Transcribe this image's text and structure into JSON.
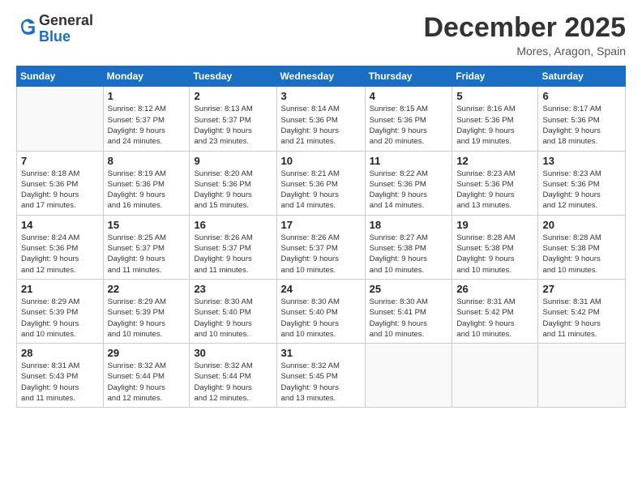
{
  "header": {
    "logo": {
      "line1": "General",
      "line2": "Blue"
    },
    "title": "December 2025",
    "location": "Mores, Aragon, Spain"
  },
  "days_of_week": [
    "Sunday",
    "Monday",
    "Tuesday",
    "Wednesday",
    "Thursday",
    "Friday",
    "Saturday"
  ],
  "weeks": [
    [
      {
        "day": "",
        "info": ""
      },
      {
        "day": "1",
        "info": "Sunrise: 8:12 AM\nSunset: 5:37 PM\nDaylight: 9 hours\nand 24 minutes."
      },
      {
        "day": "2",
        "info": "Sunrise: 8:13 AM\nSunset: 5:37 PM\nDaylight: 9 hours\nand 23 minutes."
      },
      {
        "day": "3",
        "info": "Sunrise: 8:14 AM\nSunset: 5:36 PM\nDaylight: 9 hours\nand 21 minutes."
      },
      {
        "day": "4",
        "info": "Sunrise: 8:15 AM\nSunset: 5:36 PM\nDaylight: 9 hours\nand 20 minutes."
      },
      {
        "day": "5",
        "info": "Sunrise: 8:16 AM\nSunset: 5:36 PM\nDaylight: 9 hours\nand 19 minutes."
      },
      {
        "day": "6",
        "info": "Sunrise: 8:17 AM\nSunset: 5:36 PM\nDaylight: 9 hours\nand 18 minutes."
      }
    ],
    [
      {
        "day": "7",
        "info": "Sunrise: 8:18 AM\nSunset: 5:36 PM\nDaylight: 9 hours\nand 17 minutes."
      },
      {
        "day": "8",
        "info": "Sunrise: 8:19 AM\nSunset: 5:36 PM\nDaylight: 9 hours\nand 16 minutes."
      },
      {
        "day": "9",
        "info": "Sunrise: 8:20 AM\nSunset: 5:36 PM\nDaylight: 9 hours\nand 15 minutes."
      },
      {
        "day": "10",
        "info": "Sunrise: 8:21 AM\nSunset: 5:36 PM\nDaylight: 9 hours\nand 14 minutes."
      },
      {
        "day": "11",
        "info": "Sunrise: 8:22 AM\nSunset: 5:36 PM\nDaylight: 9 hours\nand 14 minutes."
      },
      {
        "day": "12",
        "info": "Sunrise: 8:23 AM\nSunset: 5:36 PM\nDaylight: 9 hours\nand 13 minutes."
      },
      {
        "day": "13",
        "info": "Sunrise: 8:23 AM\nSunset: 5:36 PM\nDaylight: 9 hours\nand 12 minutes."
      }
    ],
    [
      {
        "day": "14",
        "info": "Sunrise: 8:24 AM\nSunset: 5:36 PM\nDaylight: 9 hours\nand 12 minutes."
      },
      {
        "day": "15",
        "info": "Sunrise: 8:25 AM\nSunset: 5:37 PM\nDaylight: 9 hours\nand 11 minutes."
      },
      {
        "day": "16",
        "info": "Sunrise: 8:26 AM\nSunset: 5:37 PM\nDaylight: 9 hours\nand 11 minutes."
      },
      {
        "day": "17",
        "info": "Sunrise: 8:26 AM\nSunset: 5:37 PM\nDaylight: 9 hours\nand 10 minutes."
      },
      {
        "day": "18",
        "info": "Sunrise: 8:27 AM\nSunset: 5:38 PM\nDaylight: 9 hours\nand 10 minutes."
      },
      {
        "day": "19",
        "info": "Sunrise: 8:28 AM\nSunset: 5:38 PM\nDaylight: 9 hours\nand 10 minutes."
      },
      {
        "day": "20",
        "info": "Sunrise: 8:28 AM\nSunset: 5:38 PM\nDaylight: 9 hours\nand 10 minutes."
      }
    ],
    [
      {
        "day": "21",
        "info": "Sunrise: 8:29 AM\nSunset: 5:39 PM\nDaylight: 9 hours\nand 10 minutes."
      },
      {
        "day": "22",
        "info": "Sunrise: 8:29 AM\nSunset: 5:39 PM\nDaylight: 9 hours\nand 10 minutes."
      },
      {
        "day": "23",
        "info": "Sunrise: 8:30 AM\nSunset: 5:40 PM\nDaylight: 9 hours\nand 10 minutes."
      },
      {
        "day": "24",
        "info": "Sunrise: 8:30 AM\nSunset: 5:40 PM\nDaylight: 9 hours\nand 10 minutes."
      },
      {
        "day": "25",
        "info": "Sunrise: 8:30 AM\nSunset: 5:41 PM\nDaylight: 9 hours\nand 10 minutes."
      },
      {
        "day": "26",
        "info": "Sunrise: 8:31 AM\nSunset: 5:42 PM\nDaylight: 9 hours\nand 10 minutes."
      },
      {
        "day": "27",
        "info": "Sunrise: 8:31 AM\nSunset: 5:42 PM\nDaylight: 9 hours\nand 11 minutes."
      }
    ],
    [
      {
        "day": "28",
        "info": "Sunrise: 8:31 AM\nSunset: 5:43 PM\nDaylight: 9 hours\nand 11 minutes."
      },
      {
        "day": "29",
        "info": "Sunrise: 8:32 AM\nSunset: 5:44 PM\nDaylight: 9 hours\nand 12 minutes."
      },
      {
        "day": "30",
        "info": "Sunrise: 8:32 AM\nSunset: 5:44 PM\nDaylight: 9 hours\nand 12 minutes."
      },
      {
        "day": "31",
        "info": "Sunrise: 8:32 AM\nSunset: 5:45 PM\nDaylight: 9 hours\nand 13 minutes."
      },
      {
        "day": "",
        "info": ""
      },
      {
        "day": "",
        "info": ""
      },
      {
        "day": "",
        "info": ""
      }
    ]
  ]
}
